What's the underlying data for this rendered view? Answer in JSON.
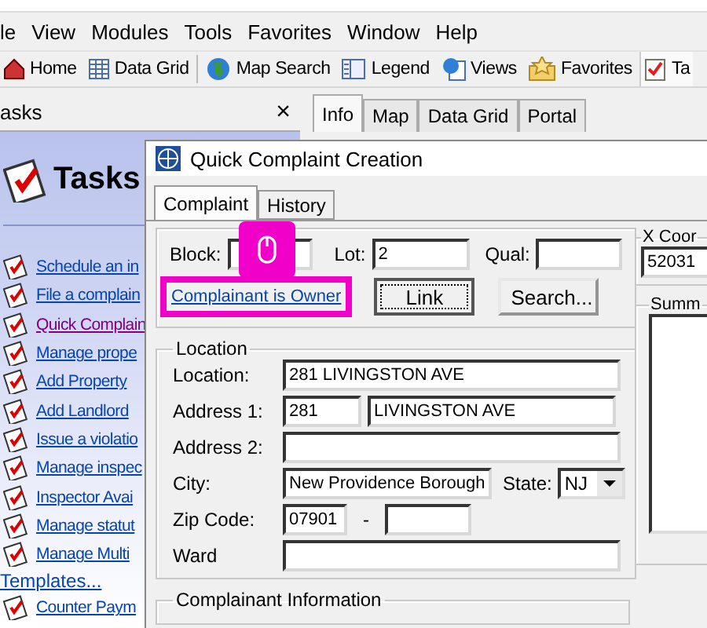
{
  "menu": [
    {
      "label": "le"
    },
    {
      "label": "View"
    },
    {
      "label": "Modules"
    },
    {
      "label": "Tools"
    },
    {
      "label": "Favorites"
    },
    {
      "label": "Window"
    },
    {
      "label": "Help"
    }
  ],
  "toolbar": [
    {
      "label": "Home",
      "kind": "home"
    },
    {
      "label": "Data Grid",
      "kind": "grid"
    },
    {
      "label": "Map Search",
      "kind": "globe"
    },
    {
      "label": "Legend",
      "kind": "legend"
    },
    {
      "label": "Views",
      "kind": "views"
    },
    {
      "label": "Favorites",
      "kind": "star"
    },
    {
      "label": "Ta",
      "kind": "tasks"
    }
  ],
  "left_pane": {
    "title": "asks",
    "close": "×",
    "heading": "Tasks",
    "links": [
      {
        "label": "Schedule an in",
        "visited": false
      },
      {
        "label": "File a complain",
        "visited": false
      },
      {
        "label": "Quick Complain",
        "visited": true
      },
      {
        "label": "Manage prope",
        "visited": false
      },
      {
        "label": "Add Property",
        "visited": false
      },
      {
        "label": "Add Landlord",
        "visited": false
      },
      {
        "label": "Issue a violatio",
        "visited": false
      },
      {
        "label": "Manage inspec",
        "visited": false
      },
      {
        "label": "Inspector Avai",
        "visited": false
      },
      {
        "label": "Manage statut",
        "visited": false
      },
      {
        "label": "Manage Multi",
        "visited": false
      }
    ],
    "section": "Templates...",
    "section_links": [
      {
        "label": "Counter Paym",
        "visited": false
      }
    ]
  },
  "main_tabs": [
    {
      "label": "Info",
      "selected": true
    },
    {
      "label": "Map",
      "selected": false
    },
    {
      "label": "Data Grid",
      "selected": false
    },
    {
      "label": "Portal",
      "selected": false
    }
  ],
  "dialog": {
    "title": "Quick Complaint Creation",
    "tabs": [
      {
        "label": "Complaint",
        "selected": true
      },
      {
        "label": "History",
        "selected": false
      }
    ],
    "block": {
      "label": "Block:"
    },
    "lot": {
      "label": "Lot:",
      "value": "2"
    },
    "qual": {
      "label": "Qual:"
    },
    "owner_link": {
      "label": "Complainant is Owner",
      "highlighted": true
    },
    "buttons": [
      {
        "label": "Link",
        "focused": true
      },
      {
        "label": "Search...",
        "focused": false
      }
    ],
    "location": {
      "title": "Location",
      "fields": [
        {
          "kind": "wide",
          "label": "Location:",
          "value": "281 LIVINGSTON AVE"
        },
        {
          "kind": "split",
          "label": "Address 1:",
          "number": "281",
          "street": "LIVINGSTON AVE"
        },
        {
          "kind": "wide",
          "label": "Address 2:"
        },
        {
          "kind": "city",
          "label": "City:",
          "value": "New Providence Borough",
          "state_label": "State:",
          "state": "NJ"
        },
        {
          "kind": "zip",
          "label": "Zip Code:",
          "value": "07901",
          "separator": "-"
        },
        {
          "kind": "wide",
          "label": "Ward"
        }
      ]
    },
    "complainant_info": {
      "title": "Complainant Information"
    },
    "x_coord": {
      "title": "X Coor",
      "value": "52031"
    },
    "summary": {
      "title": "Summ"
    }
  }
}
